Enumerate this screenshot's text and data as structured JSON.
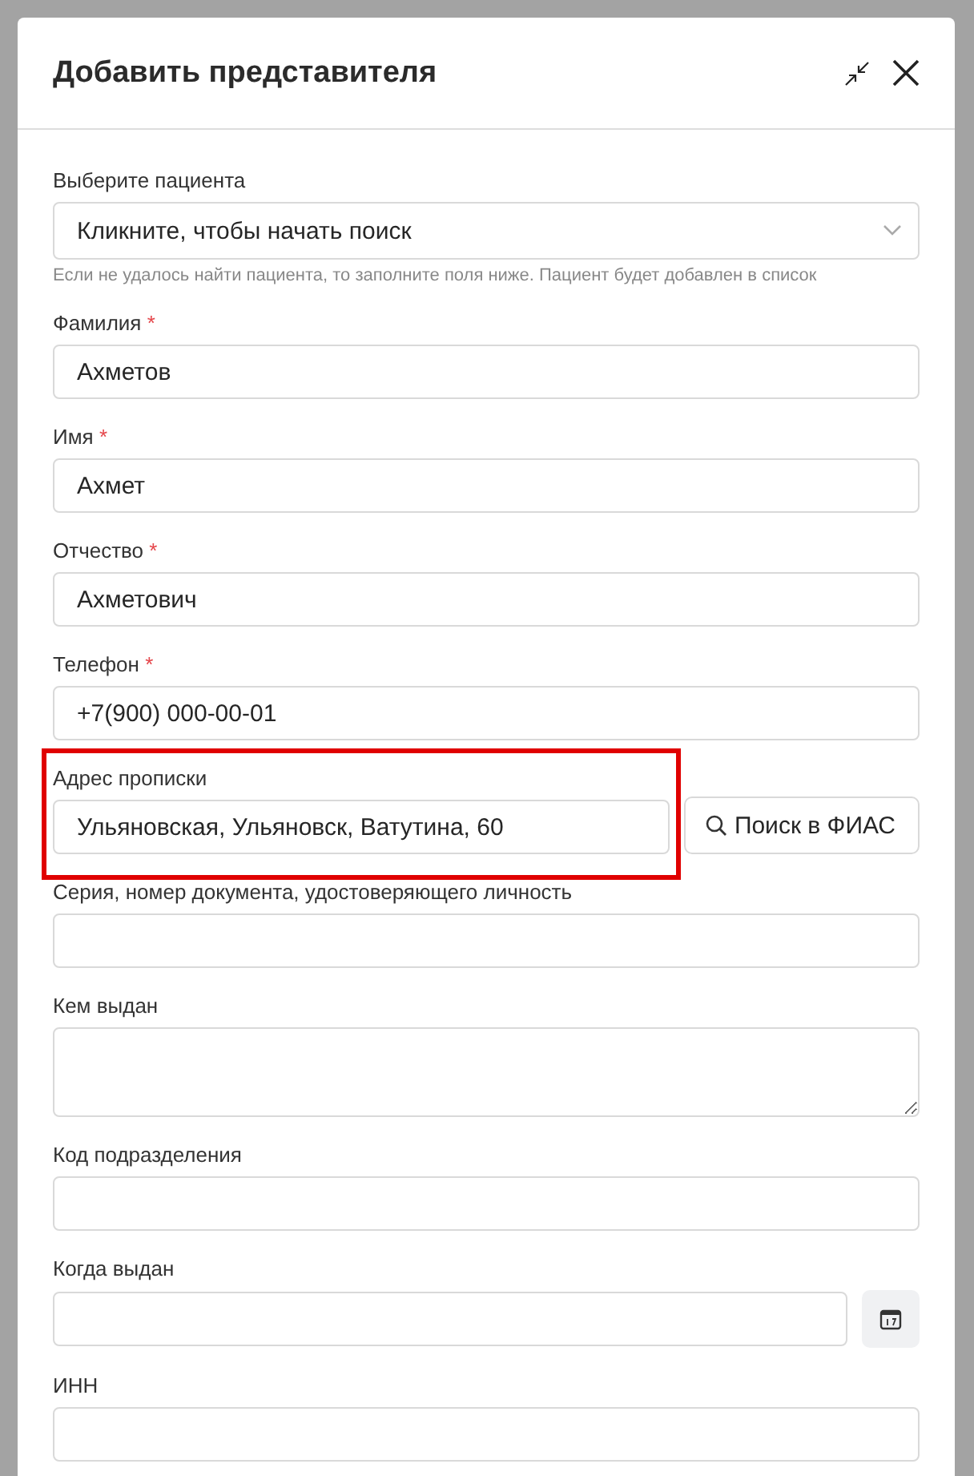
{
  "dialog": {
    "title": "Добавить представителя",
    "fields": [
      {
        "kind": "select",
        "label": "Выберите пациента",
        "placeholder": "Кликните, чтобы начать поиск",
        "hint": "Если не удалось найти пациента, то заполните поля ниже. Пациент будет добавлен в список"
      },
      {
        "kind": "text",
        "label": "Фамилия",
        "required_mark": "*",
        "value": "Ахметов"
      },
      {
        "kind": "text",
        "label": "Имя",
        "required_mark": "*",
        "value": "Ахмет"
      },
      {
        "kind": "text",
        "label": "Отчество",
        "required_mark": "*",
        "value": "Ахметович"
      },
      {
        "kind": "text",
        "label": "Телефон",
        "required_mark": "*",
        "value": "+7(900) 000-00-01"
      },
      {
        "kind": "address",
        "label": "Адрес прописки",
        "value": "Ульяновская, Ульяновск, Ватутина, 60",
        "button": "Поиск в ФИАС",
        "highlighted": true
      },
      {
        "kind": "text",
        "label": "Серия, номер документа, удостоверяющего личность"
      },
      {
        "kind": "textarea",
        "label": "Кем выдан"
      },
      {
        "kind": "text",
        "label": "Код подразделения"
      },
      {
        "kind": "date",
        "label": "Когда выдан"
      },
      {
        "kind": "text",
        "label": "ИНН"
      }
    ]
  }
}
